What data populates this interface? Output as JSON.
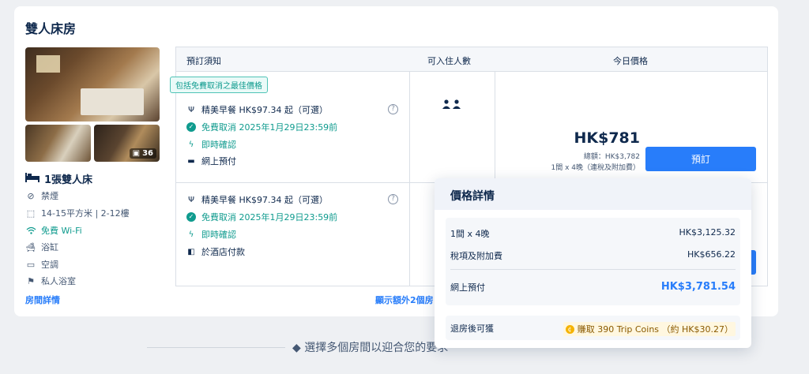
{
  "room": {
    "title": "雙人床房",
    "photo_count": "36",
    "bed": "1張雙人床",
    "amenities": [
      {
        "icon": "no-smoking-icon",
        "label": "禁煙"
      },
      {
        "icon": "area-icon",
        "label": "14-15平方米 | 2-12樓"
      },
      {
        "icon": "wifi-icon",
        "label": "免費 Wi-Fi"
      },
      {
        "icon": "bathtub-icon",
        "label": "浴缸"
      },
      {
        "icon": "air-conditioner-icon",
        "label": "空調"
      },
      {
        "icon": "private-bathroom-icon",
        "label": "私人浴室"
      }
    ],
    "details_link": "房間詳情"
  },
  "table": {
    "headers": [
      "預訂須知",
      "可入住人數",
      "今日價格"
    ],
    "tag": "包括免費取消之最佳價格",
    "rows": [
      {
        "breakfast": "精美早餐 HK$97.34 起（可選）",
        "cancel": "免費取消 2025年1月29日23:59前",
        "confirm": "即時確認",
        "payment": "網上預付",
        "guests_icon": "two-guests-icon",
        "price": "HK$781",
        "total": "總額：HK$3,782",
        "sub": "1間 x 4晚（連稅及附加費）",
        "book": "預訂"
      },
      {
        "breakfast": "精美早餐 HK$97.34 起（可選）",
        "cancel": "免費取消 2025年1月29日23:59前",
        "confirm": "即時確認",
        "payment": "於酒店付款"
      }
    ],
    "more_rooms": "顯示額外2個房"
  },
  "footer_text": "◆ 選擇多個房間以迎合您的要求",
  "price_popover": {
    "title": "價格詳情",
    "line1_label": "1間 x 4晚",
    "line1_value": "HK$3,125.32",
    "line2_label": "稅項及附加費",
    "line2_value": "HK$656.22",
    "total_label": "網上預付",
    "total_value": "HK$3,781.54",
    "reward_label": "退房後可獲",
    "reward_value": "賺取 390 Trip Coins （約 HK$30.27）"
  },
  "colors": {
    "accent": "#287dfa",
    "green": "#0f9b8e",
    "text": "#0f294d"
  }
}
